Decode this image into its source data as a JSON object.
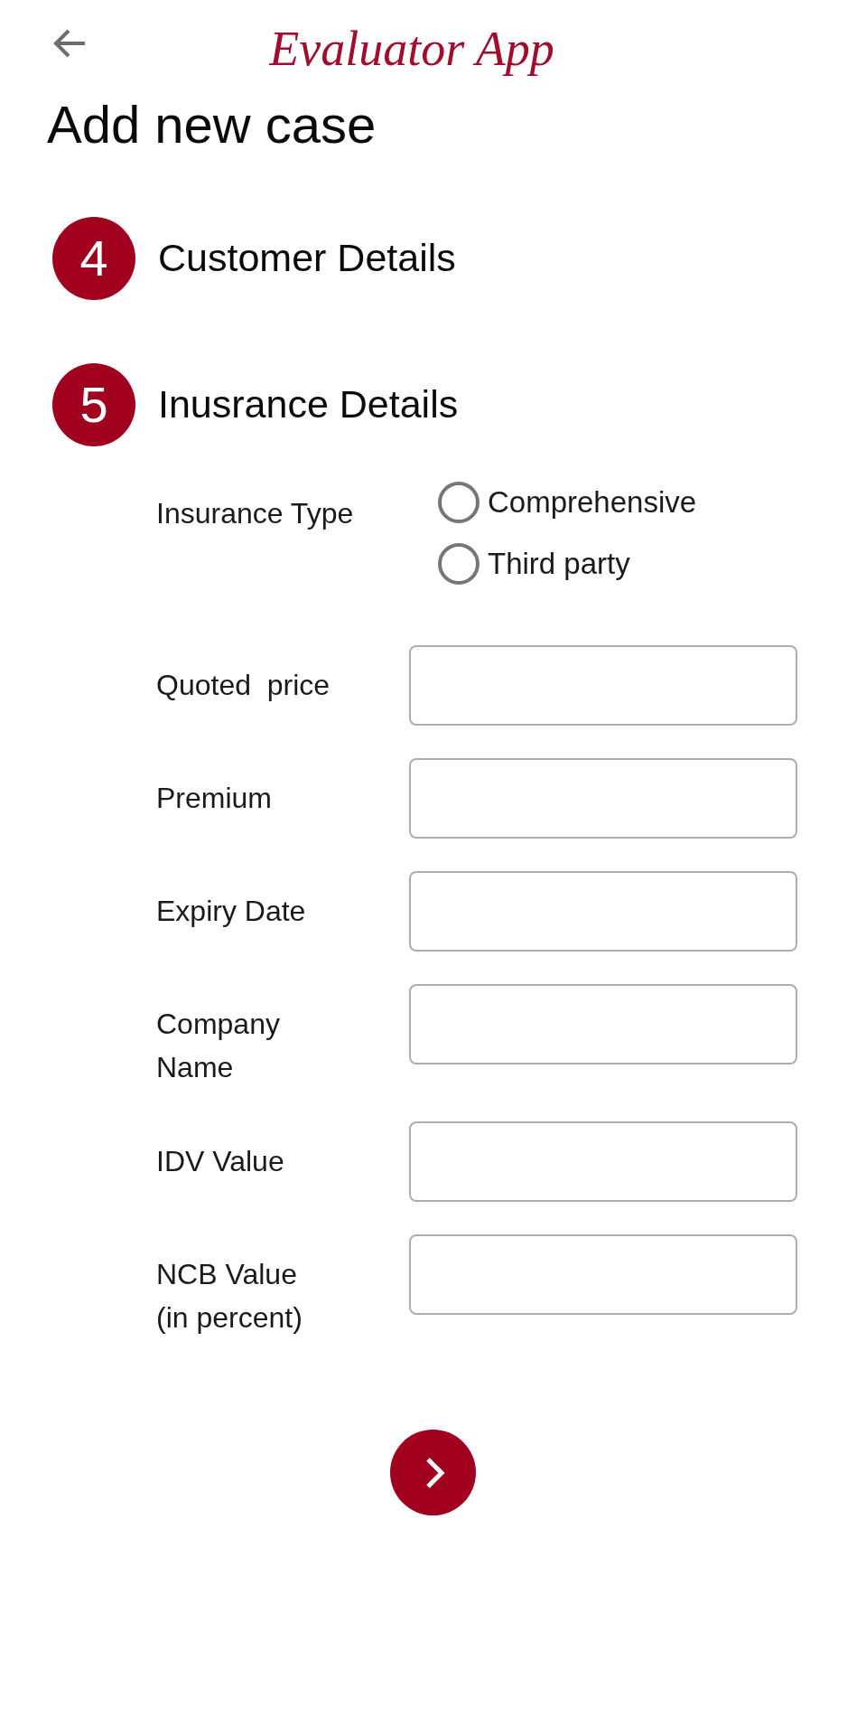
{
  "header": {
    "title": "Evaluator App"
  },
  "page_title": "Add new case",
  "steps": [
    {
      "number": "4",
      "title": "Customer Details"
    },
    {
      "number": "5",
      "title": "Inusrance Details",
      "form": {
        "insurance_type": {
          "label": "Insurance Type",
          "options": [
            {
              "label": "Comprehensive",
              "selected": false
            },
            {
              "label": "Third party",
              "selected": false
            }
          ]
        },
        "fields": [
          {
            "label": "Quoted  price"
          },
          {
            "label": "Premium"
          },
          {
            "label": "Expiry Date"
          },
          {
            "label": "Company Name"
          },
          {
            "label": "IDV Value"
          },
          {
            "label": "NCB Value (in percent)"
          }
        ]
      }
    }
  ]
}
